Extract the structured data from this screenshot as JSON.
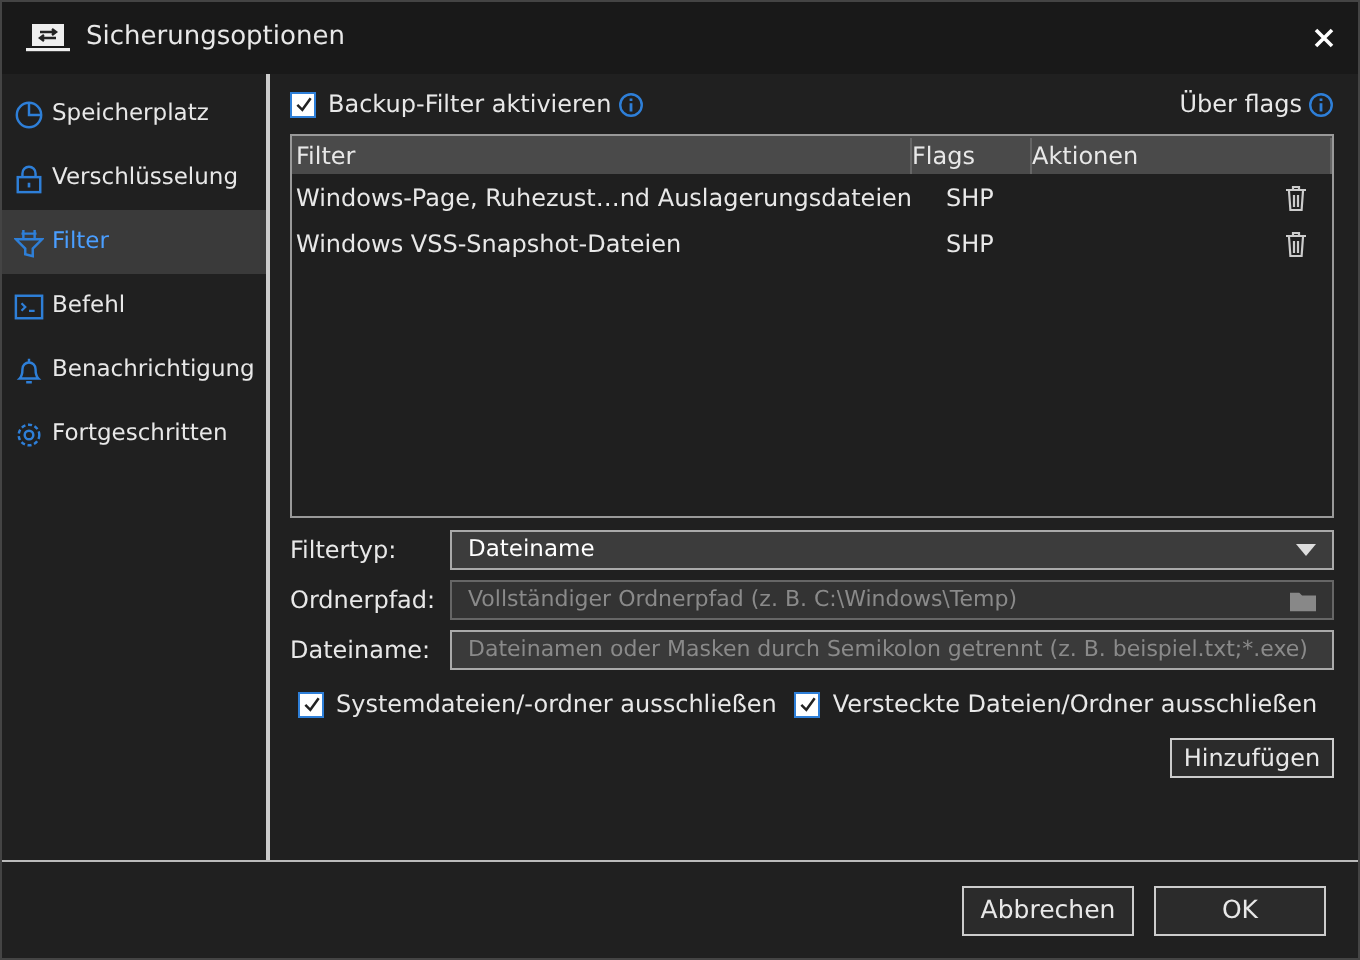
{
  "window": {
    "title": "Sicherungsoptionen"
  },
  "sidebar": {
    "items": [
      {
        "label": "Speicherplatz",
        "kind": "pie",
        "selected": false
      },
      {
        "label": "Verschlüsselung",
        "kind": "lock",
        "selected": false
      },
      {
        "label": "Filter",
        "kind": "filter",
        "selected": true
      },
      {
        "label": "Befehl",
        "kind": "terminal",
        "selected": false
      },
      {
        "label": "Benachrichtigung",
        "kind": "bell",
        "selected": false
      },
      {
        "label": "Fortgeschritten",
        "kind": "gear",
        "selected": false
      }
    ]
  },
  "enable_filter": {
    "label": "Backup-Filter aktivieren",
    "checked": true
  },
  "about_flags": "Über flags",
  "table": {
    "columns": [
      "Filter",
      "Flags",
      "Aktionen"
    ],
    "rows": [
      {
        "filter": "Windows-Page, Ruhezust…nd Auslagerungsdateien",
        "flags": "SHP"
      },
      {
        "filter": "Windows VSS-Snapshot-Dateien",
        "flags": "SHP"
      }
    ]
  },
  "form": {
    "filter_type": {
      "label": "Filtertyp:",
      "value": "Dateiname"
    },
    "folder_path": {
      "label": "Ordnerpfad:",
      "placeholder": "Vollständiger Ordnerpfad (z. B. C:\\Windows\\Temp)",
      "disabled": true
    },
    "file_name": {
      "label": "Dateiname:",
      "placeholder": "Dateinamen oder Masken durch Semikolon getrennt (z. B. beispiel.txt;*.exe)"
    }
  },
  "options": [
    {
      "label": "Systemdateien/-ordner ausschließen",
      "checked": true
    },
    {
      "label": "Versteckte Dateien/Ordner ausschließen",
      "checked": true
    }
  ],
  "add_button": "Hinzufügen",
  "buttons": [
    "Abbrechen",
    "OK"
  ]
}
